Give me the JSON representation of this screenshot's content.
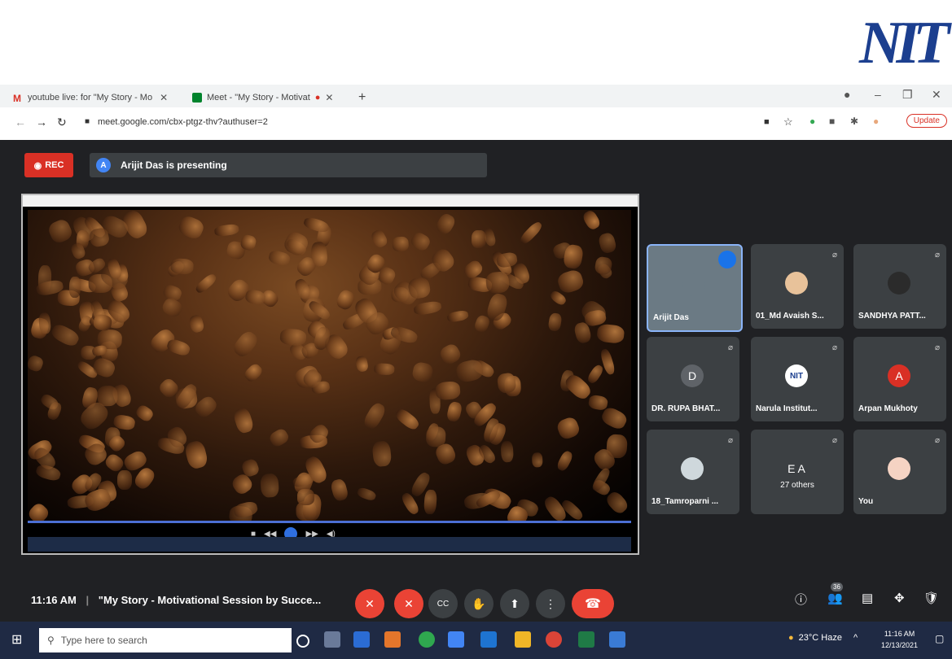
{
  "logo_text": "NIT",
  "browser": {
    "tabs": [
      {
        "label": "youtube live: for \"My Story - Mo ",
        "favicon": "gmail-icon"
      },
      {
        "label": "Meet - \"My Story - Motivat",
        "favicon": "meet-icon"
      }
    ],
    "new_tab": "+",
    "url": "meet.google.com/cbx-ptgz-thv?authuser=2",
    "update_label": "Update"
  },
  "meet": {
    "rec_label": "REC",
    "presenter_avatar": "A",
    "presenting_text": "Arijit Das is presenting",
    "tiles": [
      {
        "name": "Arijit Das",
        "avatar": "",
        "color": "#6b7a84"
      },
      {
        "name": "01_Md Avaish S...",
        "avatar": "",
        "color": "#e8c29a"
      },
      {
        "name": "SANDHYA PATT...",
        "avatar": "",
        "color": "#2b2b2b"
      },
      {
        "name": "DR. RUPA BHAT...",
        "avatar": "D",
        "color": "#5f6368"
      },
      {
        "name": "Narula Institut...",
        "avatar": "NIT",
        "color": "#ffffff"
      },
      {
        "name": "Arpan Mukhoty",
        "avatar": "A",
        "color": "#d93025"
      },
      {
        "name": "18_Tamroparni ...",
        "avatar": "",
        "color": "#cfd8dc"
      },
      {
        "name": "27 others",
        "avatar": "E A",
        "color": "#5f6368"
      },
      {
        "name": "You",
        "avatar": "",
        "color": "#f5d3c3"
      }
    ],
    "time": "11:16 AM",
    "meeting_title": "\"My Story - Motivational Session by Succe...",
    "participants_count": "36"
  },
  "taskbar": {
    "search_placeholder": "Type here to search",
    "weather": "23°C  Haze",
    "clock_time": "11:16 AM",
    "clock_date": "12/13/2021"
  }
}
